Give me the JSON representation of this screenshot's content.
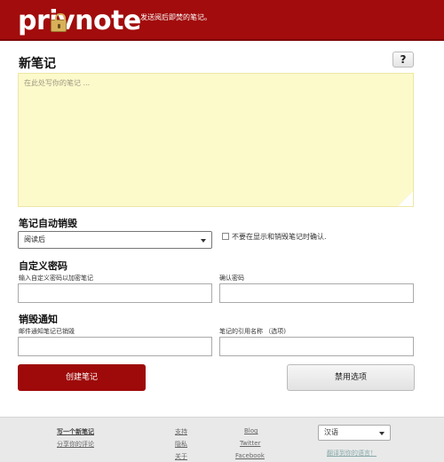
{
  "header": {
    "logo_text": "privnote",
    "tagline": "发送阅后即焚的笔记。"
  },
  "main": {
    "title": "新笔记",
    "help_label": "?",
    "note_placeholder": "在此处写你的笔记 ...",
    "self_destruct_label": "笔记自动销毁",
    "self_destruct_value": "阅读后",
    "confirm_checkbox_label": "不要在显示和销毁笔记时确认.",
    "password_section": "自定义密码",
    "password_label": "输入自定义密码以加密笔记",
    "confirm_password_label": "确认密码",
    "notify_section": "销毁通知",
    "email_label": "邮件通知笔记已销毁",
    "reference_label": "笔记的引用名称 （选项)",
    "create_button": "创建笔记",
    "disable_options_button": "禁用选项"
  },
  "footer": {
    "write_note": "写一个新笔记",
    "share_review": "分享你的评论",
    "support": "支持",
    "privacy": "隐私",
    "about": "关于",
    "blog": "Blog",
    "twitter": "Twitter",
    "facebook": "Facebook",
    "language": "汉语",
    "translate": "翻译到你的语言！"
  }
}
